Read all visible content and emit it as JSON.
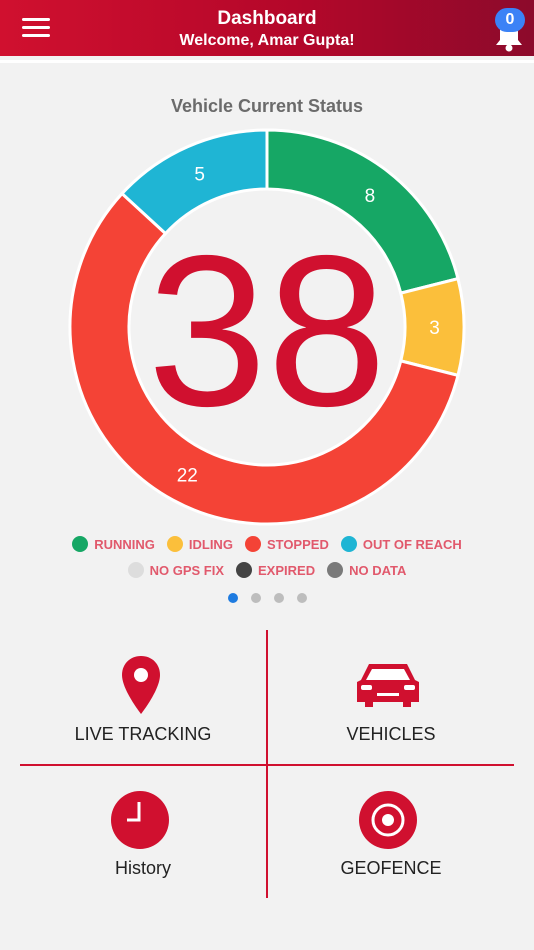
{
  "header": {
    "title": "Dashboard",
    "subtitle": "Welcome, Amar Gupta!",
    "notification_count": "0",
    "brand_color": "#d0102f"
  },
  "chart_title": "Vehicle Current Status",
  "chart_data": {
    "type": "pie",
    "center_total": "38",
    "series": [
      {
        "name": "RUNNING",
        "value": 8,
        "color": "#16a765"
      },
      {
        "name": "IDLING",
        "value": 3,
        "color": "#fbbf3b"
      },
      {
        "name": "STOPPED",
        "value": 22,
        "color": "#f44336"
      },
      {
        "name": "OUT OF REACH",
        "value": 5,
        "color": "#1fb5d4"
      }
    ]
  },
  "legend": {
    "row1": [
      {
        "label": "RUNNING",
        "color": "#16a765"
      },
      {
        "label": "IDLING",
        "color": "#fbbf3b"
      },
      {
        "label": "STOPPED",
        "color": "#f44336"
      },
      {
        "label": "OUT OF REACH",
        "color": "#1fb5d4"
      }
    ],
    "row2": [
      {
        "label": "NO GPS FIX",
        "color": "#dddddd"
      },
      {
        "label": "EXPIRED",
        "color": "#444444"
      },
      {
        "label": "NO DATA",
        "color": "#7a7a7a"
      }
    ]
  },
  "pager": {
    "count": 4,
    "active": 0
  },
  "tiles": {
    "live_tracking": "LIVE TRACKING",
    "vehicles": "VEHICLES",
    "history": "History",
    "geofence": "GEOFENCE"
  }
}
